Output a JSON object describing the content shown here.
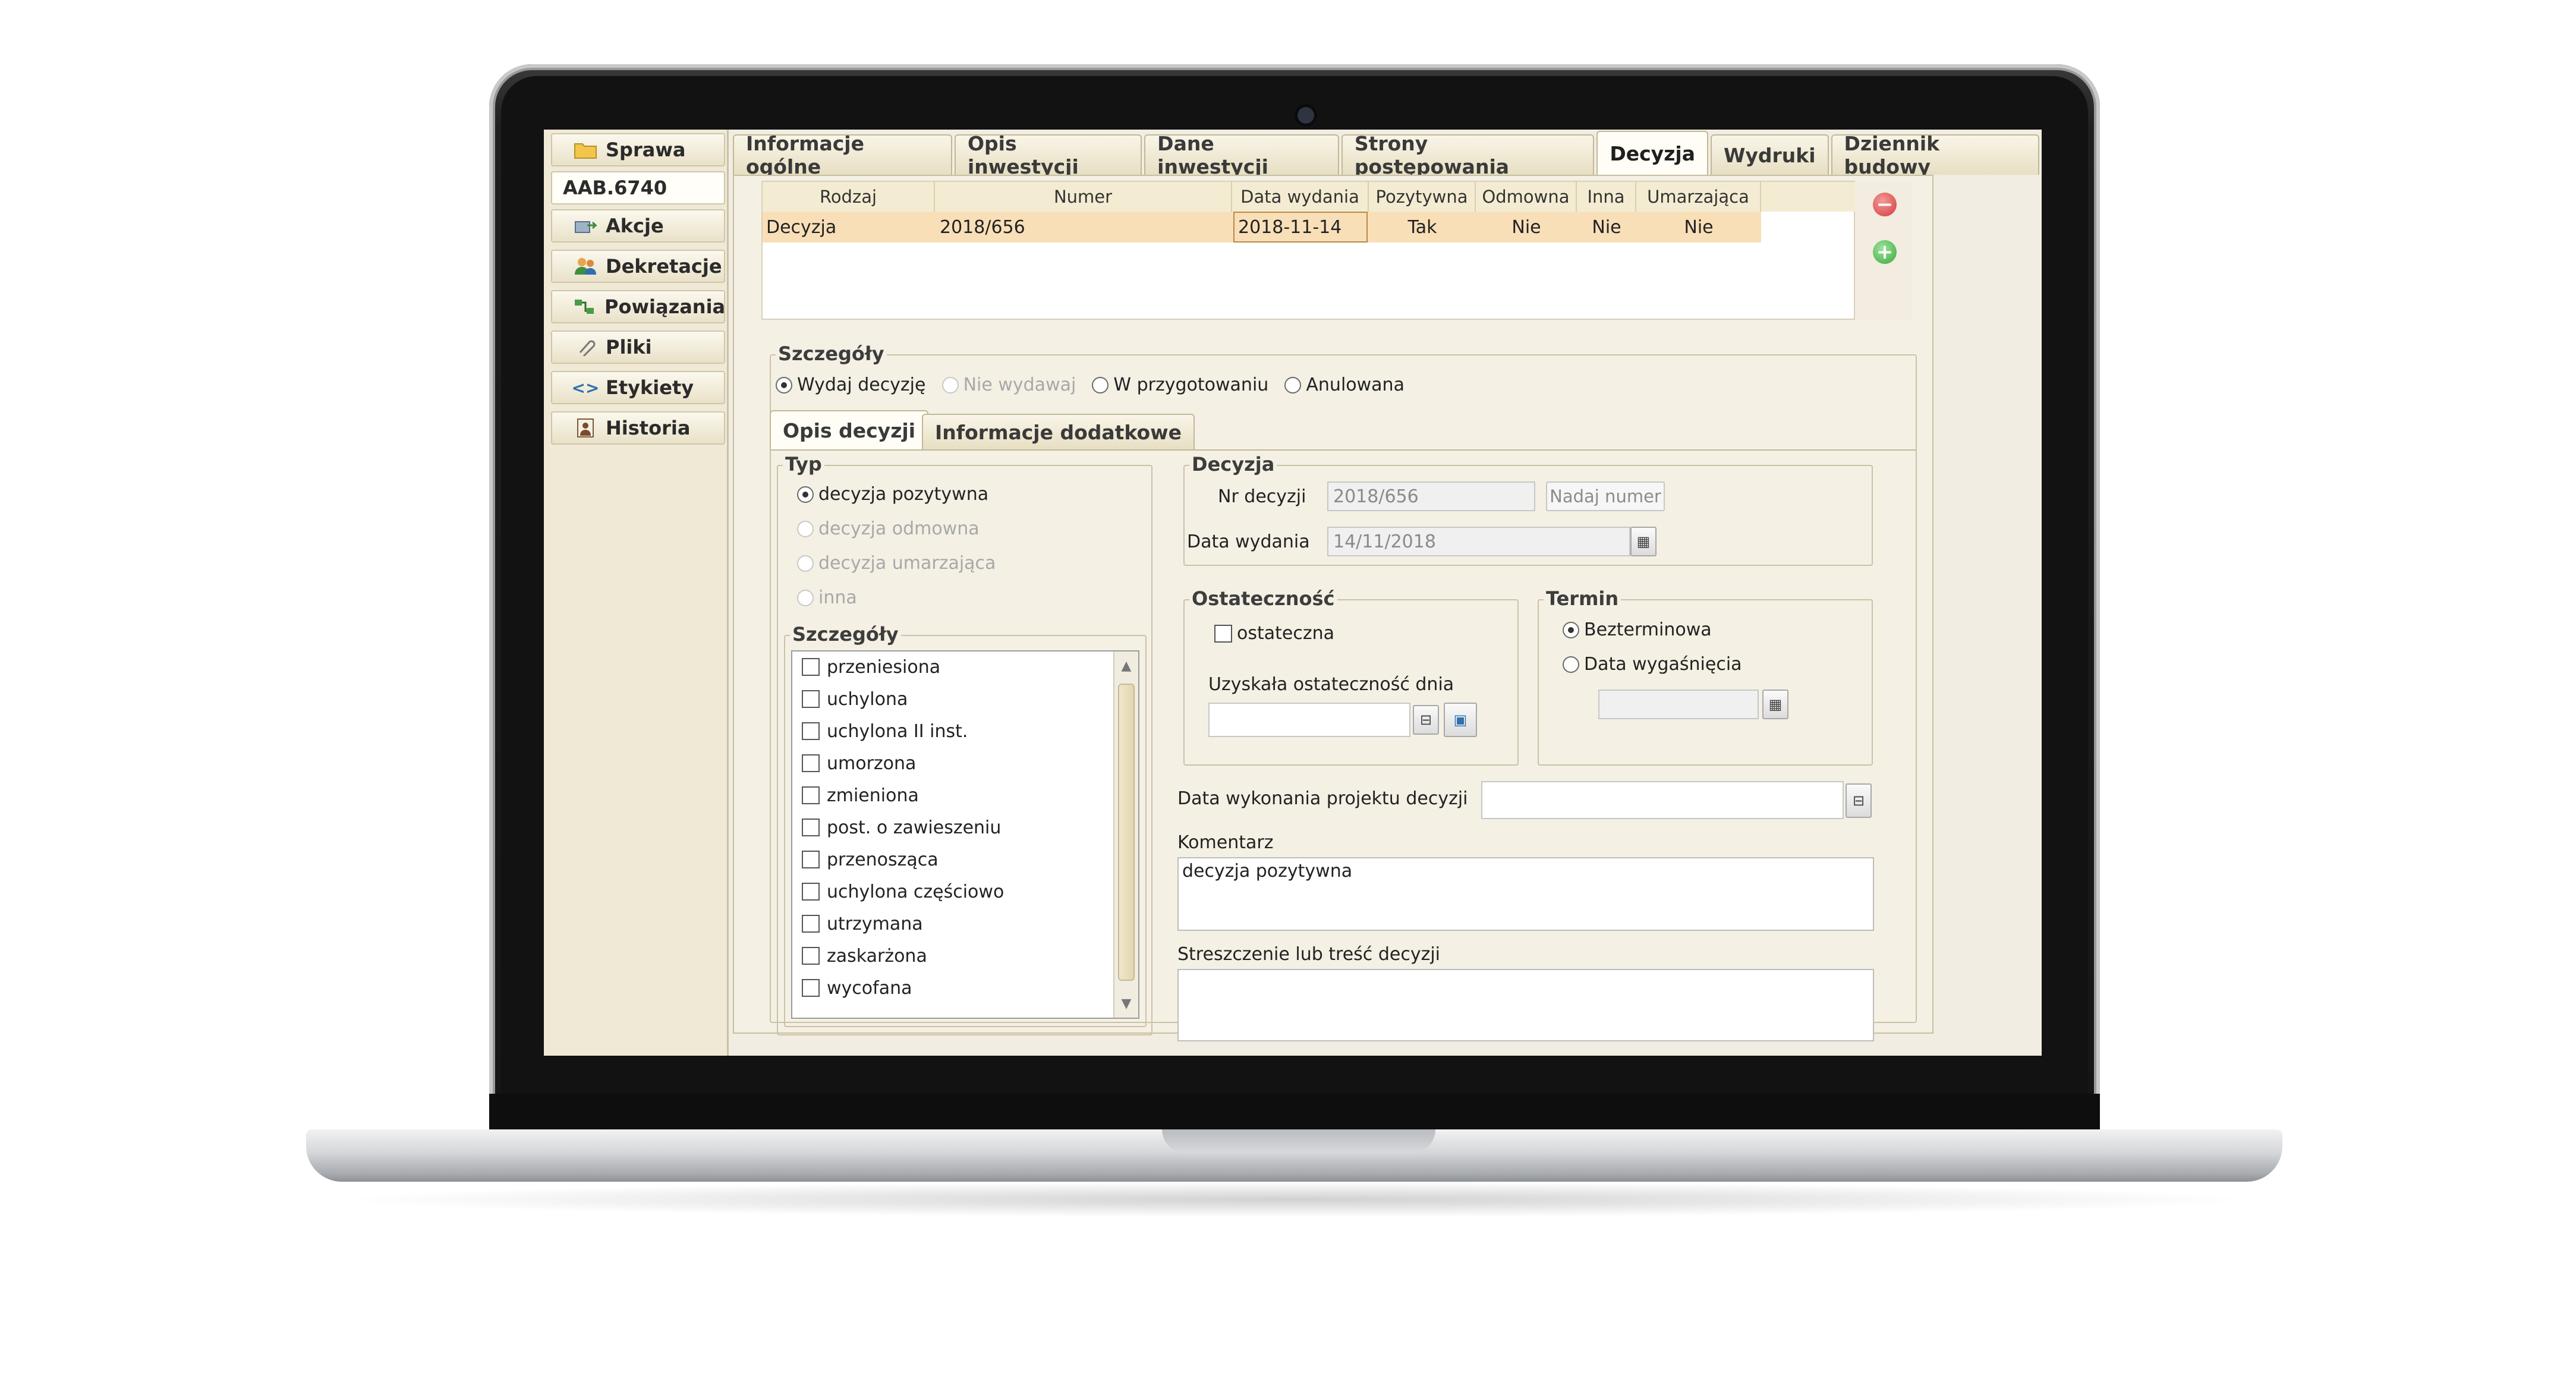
{
  "sidebar": {
    "case_id": "AAB.6740",
    "items": [
      {
        "label": "Sprawa",
        "icon": "folder-icon"
      },
      {
        "label": "Akcje",
        "icon": "actions-icon"
      },
      {
        "label": "Dekretacje",
        "icon": "users-icon"
      },
      {
        "label": "Powiązania",
        "icon": "links-icon"
      },
      {
        "label": "Pliki",
        "icon": "paperclip-icon"
      },
      {
        "label": "Etykiety",
        "icon": "code-tags-icon"
      },
      {
        "label": "Historia",
        "icon": "history-icon"
      }
    ]
  },
  "tabs": [
    "Informacje ogólne",
    "Opis inwestycji",
    "Dane inwestycji",
    "Strony postępowania",
    "Decyzja",
    "Wydruki",
    "Dziennik budowy"
  ],
  "active_tab": "Decyzja",
  "grid": {
    "columns": [
      "Rodzaj",
      "Numer",
      "Data wydania",
      "Pozytywna",
      "Odmowna",
      "Inna",
      "Umarzająca"
    ],
    "rows": [
      [
        "Decyzja",
        "2018/656",
        "2018-11-14",
        "Tak",
        "Nie",
        "Nie",
        "Nie"
      ]
    ],
    "remove_button": "−",
    "add_button": "+"
  },
  "details": {
    "legend": "Szczegóły",
    "options": [
      "Wydaj decyzję",
      "Nie wydawaj",
      "W przygotowaniu",
      "Anulowana"
    ],
    "selected": "Wydaj decyzję"
  },
  "subtabs": [
    "Opis decyzji",
    "Informacje dodatkowe"
  ],
  "typ": {
    "legend": "Typ",
    "options": [
      "decyzja pozytywna",
      "decyzja odmowna",
      "decyzja umarzająca",
      "inna"
    ],
    "selected": "decyzja pozytywna"
  },
  "szczegoly_list": {
    "legend": "Szczegóły",
    "items": [
      "przeniesiona",
      "uchylona",
      "uchylona II inst.",
      "umorzona",
      "zmieniona",
      "post. o zawieszeniu",
      "przenosząca",
      "uchylona częściowo",
      "utrzymana",
      "zaskarżona",
      "wycofana"
    ]
  },
  "decyzja": {
    "legend": "Decyzja",
    "nr_label": "Nr decyzji",
    "nr_value": "2018/656",
    "nadaj_button": "Nadaj numer",
    "data_label": "Data wydania",
    "data_value": "14/11/2018"
  },
  "ostatecznosc": {
    "legend": "Ostateczność",
    "checkbox_label": "ostateczna",
    "date_label": "Uzyskała ostateczność dnia",
    "date_value": ""
  },
  "termin": {
    "legend": "Termin",
    "options": [
      "Bezterminowa",
      "Data wygaśnięcia"
    ],
    "selected": "Bezterminowa"
  },
  "projekt": {
    "label": "Data wykonania projektu decyzji",
    "value": ""
  },
  "komentarz": {
    "label": "Komentarz",
    "value": "decyzja pozytywna"
  },
  "streszczenie": {
    "label": "Streszczenie lub treść decyzji",
    "value": ""
  }
}
